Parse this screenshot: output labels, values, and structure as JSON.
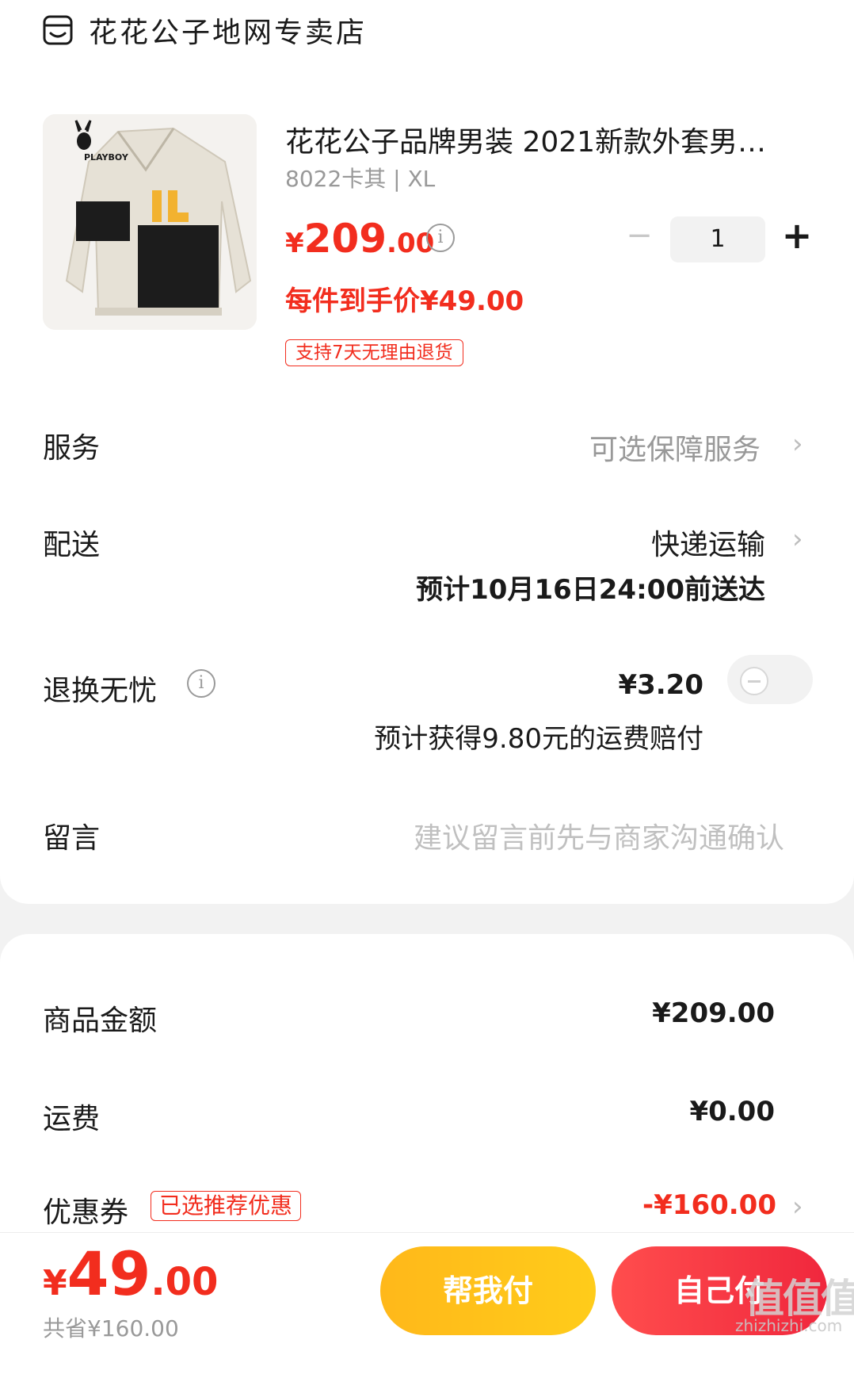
{
  "store": {
    "name": "花花公子地网专卖店",
    "icon": "store-icon"
  },
  "product": {
    "title": "花花公子品牌男装 2021新款外套男…",
    "spec": "8022卡其 | XL",
    "image_brand": "PLAYBOY",
    "price_currency": "¥",
    "price_int": "209",
    "price_dec": ".00",
    "price_each": "每件到手价¥49.00",
    "return_policy": "支持7天无理由退货",
    "quantity": "1",
    "qty_minus": "−",
    "qty_plus": "+"
  },
  "service": {
    "label": "服务",
    "value": "可选保障服务"
  },
  "delivery": {
    "label": "配送",
    "value": "快递运输",
    "eta": "预计10月16日24:00前送达"
  },
  "return_worry": {
    "label": "退换无忧",
    "price": "¥3.20",
    "compensation": "预计获得9.80元的运费赔付",
    "enabled": false
  },
  "message": {
    "label": "留言",
    "placeholder": "建议留言前先与商家沟通确认"
  },
  "summary": {
    "goods_label": "商品金额",
    "goods_value": "¥209.00",
    "shipping_label": "运费",
    "shipping_value": "¥0.00",
    "coupon_label": "优惠券",
    "coupon_badge": "已选推荐优惠",
    "coupon_value": "-¥160.00"
  },
  "bottom": {
    "total_currency": "¥",
    "total_int": "49",
    "total_dec": ".00",
    "saved": "共省¥160.00",
    "help_pay": "帮我付",
    "self_pay": "自己付"
  },
  "watermark": {
    "text": "值值值",
    "sub": "zhizhizhi.com"
  },
  "colors": {
    "accent": "#f22d1e",
    "help_button": "#ffc21a",
    "pay_button": "#f5344a"
  }
}
